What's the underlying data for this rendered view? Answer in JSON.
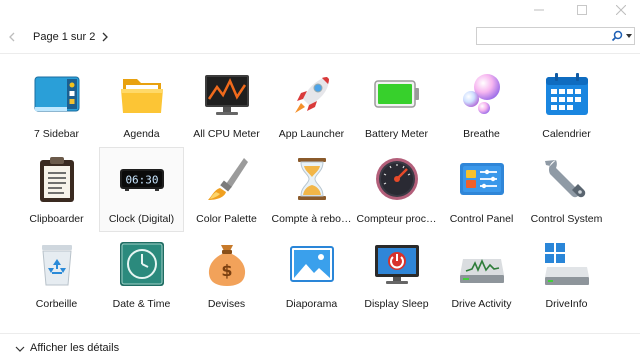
{
  "window": {
    "controls": [
      "minimize-icon",
      "maximize-icon",
      "close-icon"
    ]
  },
  "toolbar": {
    "page_label": "Page 1 sur 2",
    "search_value": "",
    "icons": [
      "chevron-left-icon",
      "chevron-right-icon",
      "search-icon",
      "dropdown-arrow-icon"
    ]
  },
  "gadgets": [
    [
      {
        "label": "7 Sidebar",
        "icon": "sidebar-icon"
      },
      {
        "label": "Agenda",
        "icon": "folder-icon"
      },
      {
        "label": "All CPU Meter",
        "icon": "cpu-meter-icon"
      },
      {
        "label": "App Launcher",
        "icon": "rocket-icon"
      },
      {
        "label": "Battery Meter",
        "icon": "battery-icon"
      },
      {
        "label": "Breathe",
        "icon": "bubbles-icon"
      },
      {
        "label": "Calendrier",
        "icon": "calendar-icon"
      }
    ],
    [
      {
        "label": "Clipboarder",
        "icon": "clipboard-icon"
      },
      {
        "label": "Clock (Digital)",
        "icon": "digital-clock-icon",
        "clock_text": "06:30",
        "selected": true
      },
      {
        "label": "Color Palette",
        "icon": "paintbrush-icon"
      },
      {
        "label": "Compte à rebo…",
        "icon": "hourglass-icon"
      },
      {
        "label": "Compteur proc…",
        "icon": "speedometer-icon"
      },
      {
        "label": "Control Panel",
        "icon": "control-panel-icon"
      },
      {
        "label": "Control System",
        "icon": "wrench-icon"
      }
    ],
    [
      {
        "label": "Corbeille",
        "icon": "recycle-bin-icon"
      },
      {
        "label": "Date & Time",
        "icon": "clock-icon"
      },
      {
        "label": "Devises",
        "icon": "money-bag-icon"
      },
      {
        "label": "Diaporama",
        "icon": "picture-icon"
      },
      {
        "label": "Display Sleep",
        "icon": "monitor-power-icon"
      },
      {
        "label": "Drive Activity",
        "icon": "drive-activity-icon"
      },
      {
        "label": "DriveInfo",
        "icon": "drive-info-icon"
      }
    ]
  ],
  "footer": {
    "details_label": "Afficher les détails",
    "icon": "chevron-down-icon"
  },
  "colors": {
    "battery_green": "#37d02c",
    "calendar_blue": "#1a86e0",
    "selection_border": "#e4e4e4"
  }
}
